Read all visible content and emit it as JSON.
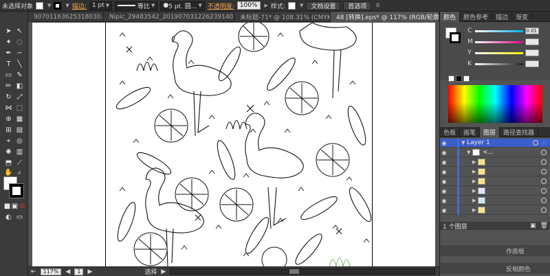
{
  "control_bar": {
    "selection_label": "未选择对象",
    "stroke_label": "描边:",
    "stroke_weight": "1 pt",
    "profile_label": "等比",
    "brush_label": "5 pt. 圆...",
    "opacity_label": "不透明度:",
    "opacity_value": "100%",
    "style_label": "样式:",
    "doc_setup_button": "文档设置",
    "preferences_button": "首选项"
  },
  "tabs": [
    {
      "label": "90701163625318030.ai*",
      "active": false
    },
    {
      "label": "Nipic_29483542_20190703122623914086.ai*",
      "active": false
    },
    {
      "label": "未标题-71* @ 108.31% (CMYK/...",
      "active": false
    },
    {
      "label": "48 [转换].eps* @ 117% (RGB/轮廓)",
      "active": true
    }
  ],
  "status_bar": {
    "zoom": "117%",
    "page": "1",
    "mode": "选择"
  },
  "panels": {
    "top_tabs": [
      "颜色",
      "颜色参考",
      "描边",
      "渐变"
    ],
    "color_channels": [
      {
        "channel": "C",
        "value": "0.01",
        "color": "#00aeef"
      },
      {
        "channel": "M",
        "value": "",
        "color": "#ec008c"
      },
      {
        "channel": "Y",
        "value": "",
        "color": "#fff200"
      },
      {
        "channel": "K",
        "value": "",
        "color": "#231f20"
      }
    ],
    "layer_tabs": [
      "色板",
      "画笔",
      "图层",
      "路径查找器"
    ],
    "layer_name": "Layer 1",
    "sublayer_name": "<...",
    "layers_count": "1 个图层",
    "bottom_panel_1": "作画板",
    "bottom_panel_2": "反相颜色"
  },
  "accent_colors": {
    "orange_label": "#f0a34a",
    "layer_blue": "#3a6fd8",
    "panel_bg": "#535353"
  }
}
